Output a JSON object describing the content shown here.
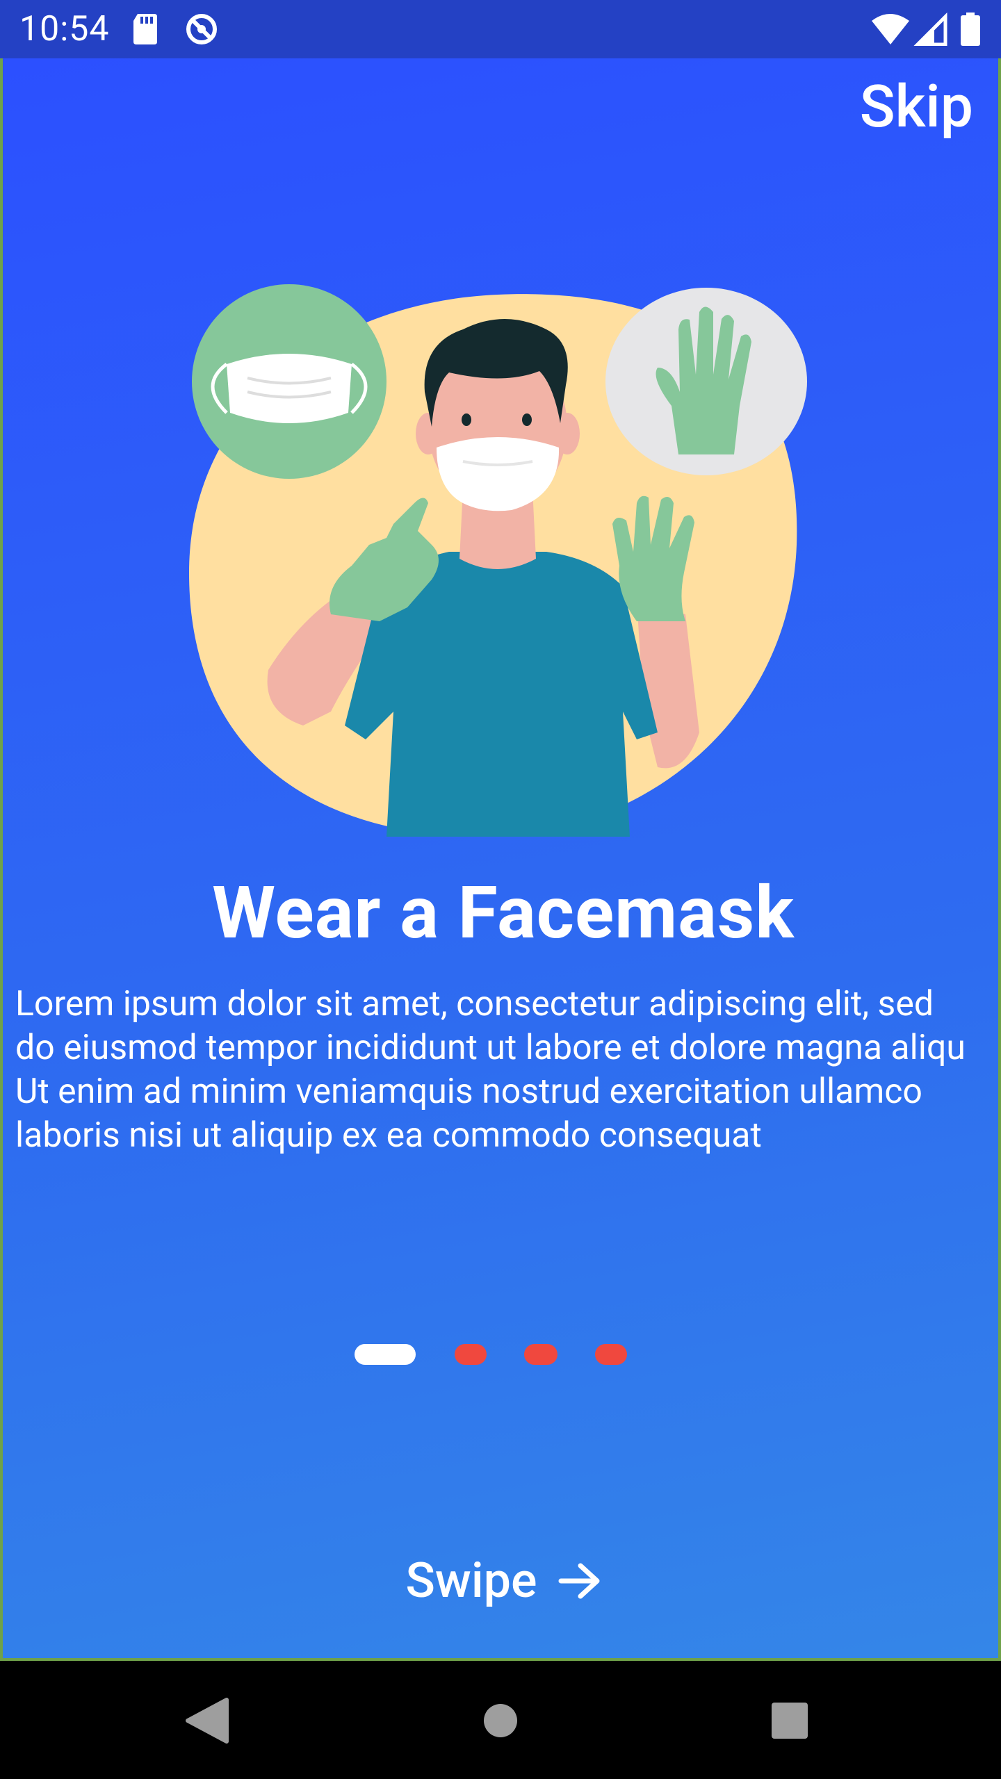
{
  "status_bar": {
    "time": "10:54",
    "icons": [
      "sd-card-icon",
      "no-data-saver-icon",
      "wifi-icon",
      "signal-icon",
      "battery-icon"
    ]
  },
  "header": {
    "skip_label": "Skip"
  },
  "onboarding": {
    "title": "Wear a Facemask",
    "description": "Lorem ipsum dolor sit amet, consectetur adipiscing elit, sed do eiusmod tempor incididunt ut labore et dolore magna aliqu Ut enim ad minim veniamquis nostrud exercitation ullamco laboris nisi ut aliquip ex ea commodo consequat",
    "page_indicator": {
      "total_pages": 4,
      "current_page": 1
    },
    "swipe_label": "Swipe"
  },
  "colors": {
    "status_bar": "#2441C4",
    "background_top": "#2C50FF",
    "background_bottom": "#3486E8",
    "indicator_active": "#FFFFFF",
    "indicator_inactive": "#F0483E",
    "text": "#FFFFFF"
  },
  "nav_bar": {
    "icons": [
      "back-icon",
      "home-icon",
      "recents-icon"
    ]
  }
}
